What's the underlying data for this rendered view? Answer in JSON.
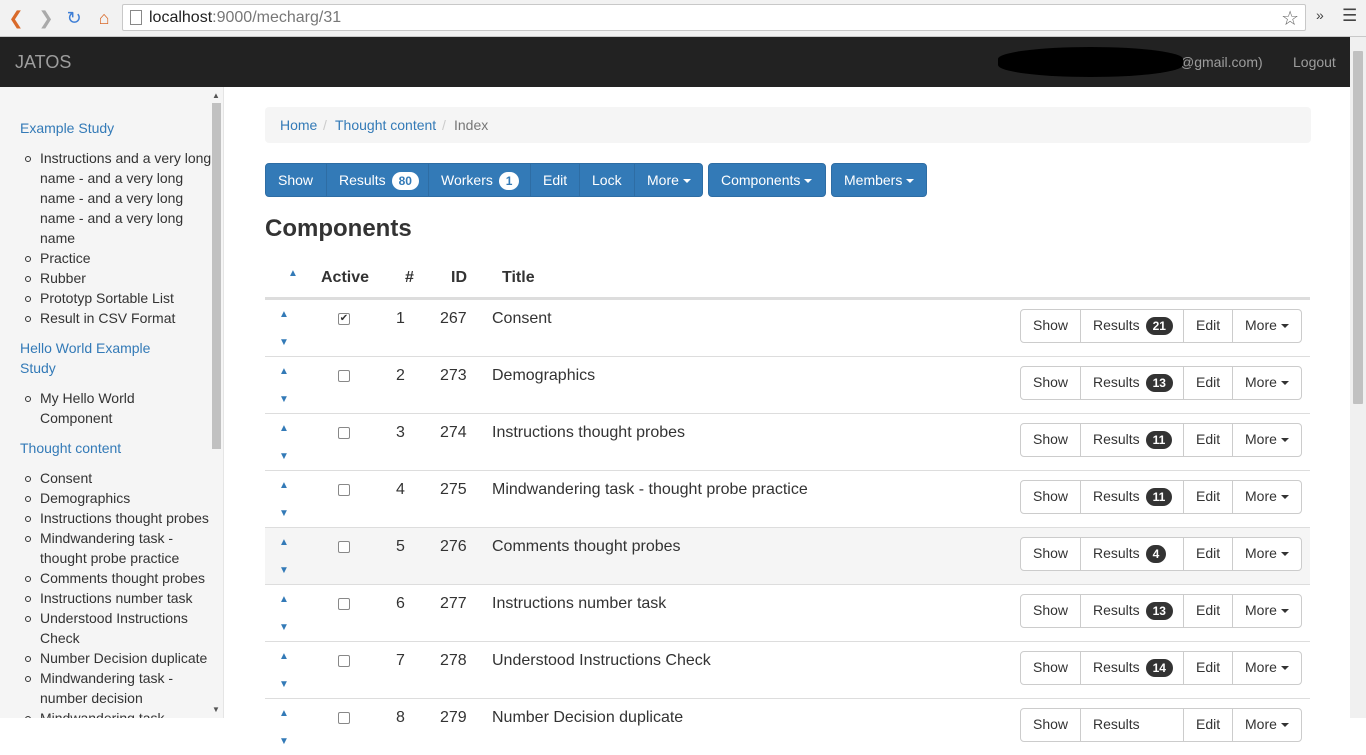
{
  "browser": {
    "url_host": "localhost",
    "url_rest": ":9000/mecharg/31"
  },
  "navbar": {
    "brand": "JATOS",
    "user": "@gmail.com)",
    "logout": "Logout"
  },
  "sidebar": {
    "studies": [
      {
        "name": "Example Study",
        "components": [
          "Instructions and a very long name - and a very long name - and a very long name - and a very long name",
          "Practice",
          "Rubber",
          "Prototyp Sortable List",
          "Result in CSV Format"
        ]
      },
      {
        "name": "Hello World Example Study",
        "components": [
          "My Hello World Component"
        ]
      },
      {
        "name": "Thought content",
        "components": [
          "Consent",
          "Demographics",
          "Instructions thought probes",
          "Mindwandering task - thought probe practice",
          "Comments thought probes",
          "Instructions number task",
          "Understood Instructions Check",
          "Number Decision duplicate",
          "Mindwandering task - number decision",
          "Mindwandering task"
        ]
      }
    ]
  },
  "breadcrumb": {
    "home": "Home",
    "study": "Thought content",
    "current": "Index"
  },
  "toolbar": {
    "show": "Show",
    "results": "Results",
    "results_count": "80",
    "workers": "Workers",
    "workers_count": "1",
    "edit": "Edit",
    "lock": "Lock",
    "more": "More",
    "components": "Components",
    "members": "Members"
  },
  "heading": "Components",
  "table": {
    "headers": {
      "active": "Active",
      "num": "#",
      "id": "ID",
      "title": "Title"
    },
    "row_buttons": {
      "show": "Show",
      "results": "Results",
      "edit": "Edit",
      "more": "More"
    },
    "rows": [
      {
        "active": true,
        "num": "1",
        "id": "267",
        "title": "Consent",
        "results": "21"
      },
      {
        "active": false,
        "num": "2",
        "id": "273",
        "title": "Demographics",
        "results": "13"
      },
      {
        "active": false,
        "num": "3",
        "id": "274",
        "title": "Instructions thought probes",
        "results": "11"
      },
      {
        "active": false,
        "num": "4",
        "id": "275",
        "title": "Mindwandering task - thought probe practice",
        "results": "11"
      },
      {
        "active": false,
        "num": "5",
        "id": "276",
        "title": "Comments thought probes",
        "results": "4"
      },
      {
        "active": false,
        "num": "6",
        "id": "277",
        "title": "Instructions number task",
        "results": "13"
      },
      {
        "active": false,
        "num": "7",
        "id": "278",
        "title": "Understood Instructions Check",
        "results": "14"
      },
      {
        "active": false,
        "num": "8",
        "id": "279",
        "title": "Number Decision duplicate",
        "results": ""
      }
    ]
  }
}
